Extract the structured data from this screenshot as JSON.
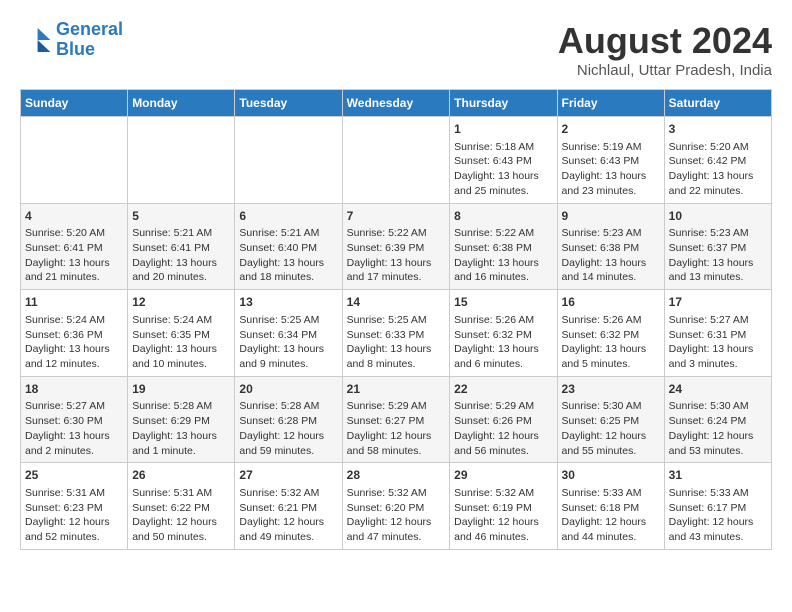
{
  "header": {
    "logo_line1": "General",
    "logo_line2": "Blue",
    "month_year": "August 2024",
    "location": "Nichlaul, Uttar Pradesh, India"
  },
  "days_of_week": [
    "Sunday",
    "Monday",
    "Tuesday",
    "Wednesday",
    "Thursday",
    "Friday",
    "Saturday"
  ],
  "weeks": [
    [
      {
        "day": "",
        "info": ""
      },
      {
        "day": "",
        "info": ""
      },
      {
        "day": "",
        "info": ""
      },
      {
        "day": "",
        "info": ""
      },
      {
        "day": "1",
        "info": "Sunrise: 5:18 AM\nSunset: 6:43 PM\nDaylight: 13 hours and 25 minutes."
      },
      {
        "day": "2",
        "info": "Sunrise: 5:19 AM\nSunset: 6:43 PM\nDaylight: 13 hours and 23 minutes."
      },
      {
        "day": "3",
        "info": "Sunrise: 5:20 AM\nSunset: 6:42 PM\nDaylight: 13 hours and 22 minutes."
      }
    ],
    [
      {
        "day": "4",
        "info": "Sunrise: 5:20 AM\nSunset: 6:41 PM\nDaylight: 13 hours and 21 minutes."
      },
      {
        "day": "5",
        "info": "Sunrise: 5:21 AM\nSunset: 6:41 PM\nDaylight: 13 hours and 20 minutes."
      },
      {
        "day": "6",
        "info": "Sunrise: 5:21 AM\nSunset: 6:40 PM\nDaylight: 13 hours and 18 minutes."
      },
      {
        "day": "7",
        "info": "Sunrise: 5:22 AM\nSunset: 6:39 PM\nDaylight: 13 hours and 17 minutes."
      },
      {
        "day": "8",
        "info": "Sunrise: 5:22 AM\nSunset: 6:38 PM\nDaylight: 13 hours and 16 minutes."
      },
      {
        "day": "9",
        "info": "Sunrise: 5:23 AM\nSunset: 6:38 PM\nDaylight: 13 hours and 14 minutes."
      },
      {
        "day": "10",
        "info": "Sunrise: 5:23 AM\nSunset: 6:37 PM\nDaylight: 13 hours and 13 minutes."
      }
    ],
    [
      {
        "day": "11",
        "info": "Sunrise: 5:24 AM\nSunset: 6:36 PM\nDaylight: 13 hours and 12 minutes."
      },
      {
        "day": "12",
        "info": "Sunrise: 5:24 AM\nSunset: 6:35 PM\nDaylight: 13 hours and 10 minutes."
      },
      {
        "day": "13",
        "info": "Sunrise: 5:25 AM\nSunset: 6:34 PM\nDaylight: 13 hours and 9 minutes."
      },
      {
        "day": "14",
        "info": "Sunrise: 5:25 AM\nSunset: 6:33 PM\nDaylight: 13 hours and 8 minutes."
      },
      {
        "day": "15",
        "info": "Sunrise: 5:26 AM\nSunset: 6:32 PM\nDaylight: 13 hours and 6 minutes."
      },
      {
        "day": "16",
        "info": "Sunrise: 5:26 AM\nSunset: 6:32 PM\nDaylight: 13 hours and 5 minutes."
      },
      {
        "day": "17",
        "info": "Sunrise: 5:27 AM\nSunset: 6:31 PM\nDaylight: 13 hours and 3 minutes."
      }
    ],
    [
      {
        "day": "18",
        "info": "Sunrise: 5:27 AM\nSunset: 6:30 PM\nDaylight: 13 hours and 2 minutes."
      },
      {
        "day": "19",
        "info": "Sunrise: 5:28 AM\nSunset: 6:29 PM\nDaylight: 13 hours and 1 minute."
      },
      {
        "day": "20",
        "info": "Sunrise: 5:28 AM\nSunset: 6:28 PM\nDaylight: 12 hours and 59 minutes."
      },
      {
        "day": "21",
        "info": "Sunrise: 5:29 AM\nSunset: 6:27 PM\nDaylight: 12 hours and 58 minutes."
      },
      {
        "day": "22",
        "info": "Sunrise: 5:29 AM\nSunset: 6:26 PM\nDaylight: 12 hours and 56 minutes."
      },
      {
        "day": "23",
        "info": "Sunrise: 5:30 AM\nSunset: 6:25 PM\nDaylight: 12 hours and 55 minutes."
      },
      {
        "day": "24",
        "info": "Sunrise: 5:30 AM\nSunset: 6:24 PM\nDaylight: 12 hours and 53 minutes."
      }
    ],
    [
      {
        "day": "25",
        "info": "Sunrise: 5:31 AM\nSunset: 6:23 PM\nDaylight: 12 hours and 52 minutes."
      },
      {
        "day": "26",
        "info": "Sunrise: 5:31 AM\nSunset: 6:22 PM\nDaylight: 12 hours and 50 minutes."
      },
      {
        "day": "27",
        "info": "Sunrise: 5:32 AM\nSunset: 6:21 PM\nDaylight: 12 hours and 49 minutes."
      },
      {
        "day": "28",
        "info": "Sunrise: 5:32 AM\nSunset: 6:20 PM\nDaylight: 12 hours and 47 minutes."
      },
      {
        "day": "29",
        "info": "Sunrise: 5:32 AM\nSunset: 6:19 PM\nDaylight: 12 hours and 46 minutes."
      },
      {
        "day": "30",
        "info": "Sunrise: 5:33 AM\nSunset: 6:18 PM\nDaylight: 12 hours and 44 minutes."
      },
      {
        "day": "31",
        "info": "Sunrise: 5:33 AM\nSunset: 6:17 PM\nDaylight: 12 hours and 43 minutes."
      }
    ]
  ]
}
